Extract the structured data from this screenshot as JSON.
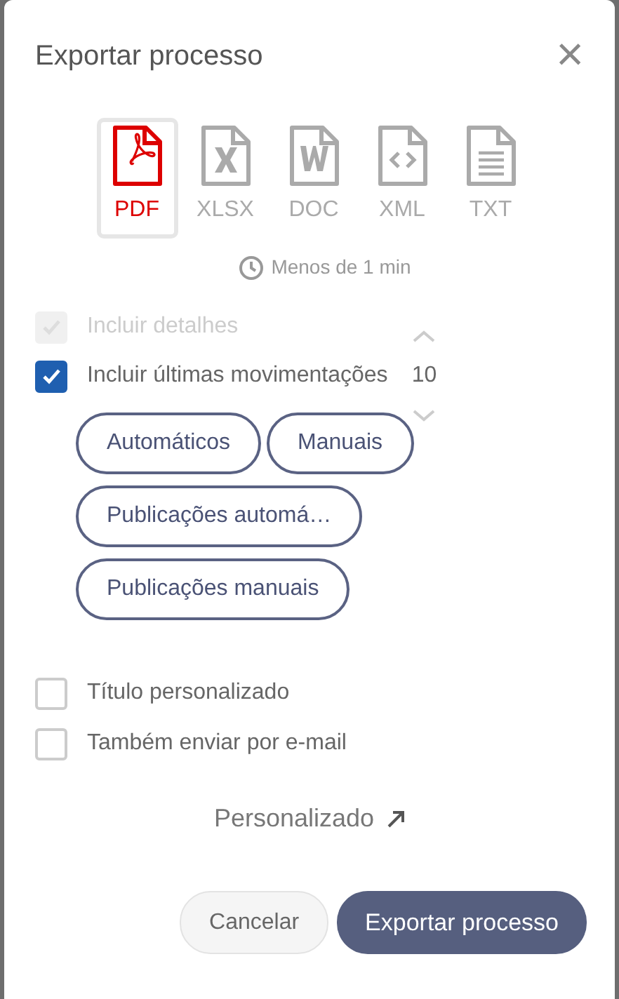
{
  "dialog": {
    "title": "Exportar processo",
    "close": "×"
  },
  "formats": [
    {
      "kind": "pdf",
      "label": "PDF",
      "selected": true
    },
    {
      "kind": "xlsx",
      "label": "XLSX",
      "selected": false
    },
    {
      "kind": "doc",
      "label": "DOC",
      "selected": false
    },
    {
      "kind": "xml",
      "label": "XML",
      "selected": false
    },
    {
      "kind": "txt",
      "label": "TXT",
      "selected": false
    }
  ],
  "estimate": "Menos de 1 min",
  "options": [
    {
      "label": "Incluir detalhes",
      "checked": true,
      "disabled": true
    },
    {
      "label": "Incluir últimas movimentações",
      "checked": true,
      "disabled": false,
      "count": "10"
    }
  ],
  "filters": [
    "Automáticos",
    "Manuais",
    "Publicações automá…",
    "Publicações manuais"
  ],
  "extra_options": [
    {
      "label": "Título personalizado",
      "checked": false,
      "disabled": false
    },
    {
      "label": "Também enviar por e-mail",
      "checked": false,
      "disabled": false
    }
  ],
  "custom_link": "Personalizado",
  "buttons": [
    {
      "kind": "secondary",
      "label": "Cancelar"
    },
    {
      "kind": "primary",
      "label": "Exportar processo"
    }
  ]
}
